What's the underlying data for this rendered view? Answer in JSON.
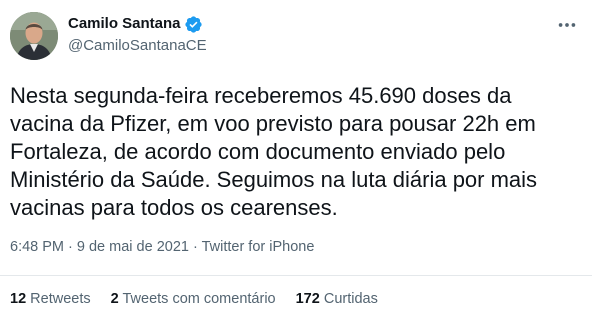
{
  "author": {
    "name": "Camilo Santana",
    "handle": "@CamiloSantanaCE",
    "verified": true,
    "avatar_icon": "profile-photo"
  },
  "tweet": {
    "text": "Nesta segunda-feira receberemos 45.690 doses da\nvacina da Pfizer, em voo previsto para pousar 22h em\nFortaleza, de acordo com documento enviado pelo\nMinistério da Saúde. Seguimos na luta diária por mais\nvacinas para todos os cearenses.",
    "time": "6:48 PM",
    "date": "9 de mai de 2021",
    "source": "Twitter for iPhone",
    "separator": " · "
  },
  "stats": {
    "retweets_count": "12",
    "retweets_label": "Retweets",
    "quotes_count": "2",
    "quotes_label": "Tweets com comentário",
    "likes_count": "172",
    "likes_label": "Curtidas"
  },
  "icons": {
    "more": "more-horizontal-icon",
    "verified": "verified-badge-icon"
  },
  "colors": {
    "text": "#0f1419",
    "secondary": "#536471",
    "verified": "#1d9bf0",
    "divider": "#e4e8eb"
  }
}
